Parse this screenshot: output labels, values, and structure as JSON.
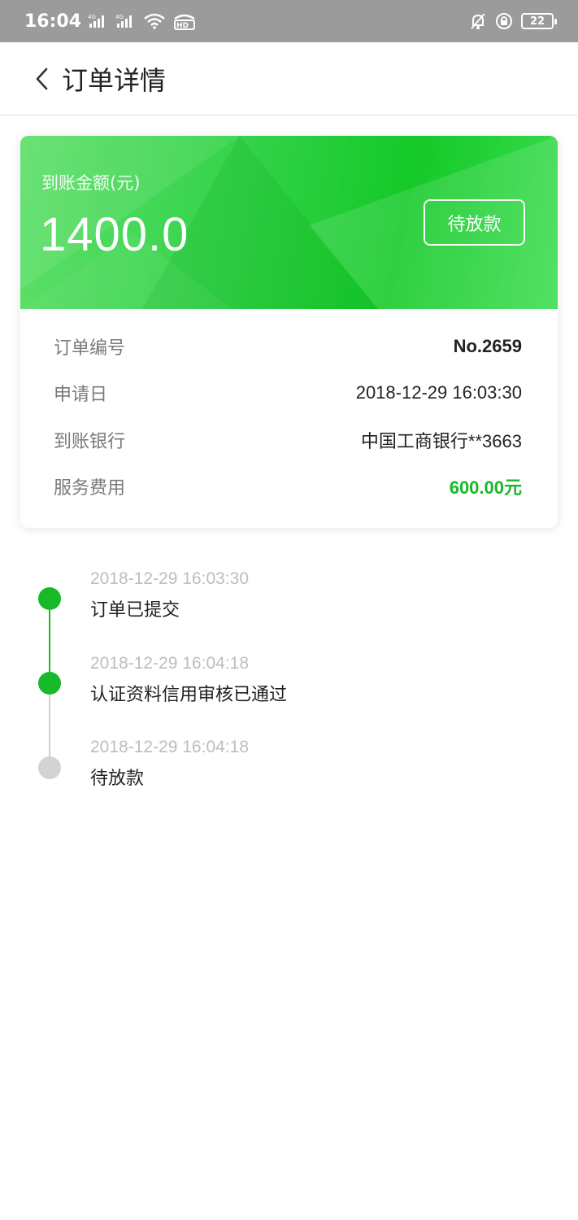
{
  "status_bar": {
    "time": "16:04",
    "battery": "22"
  },
  "nav": {
    "title": "订单详情"
  },
  "card": {
    "amount_label": "到账金额(元)",
    "amount_value": "1400.0",
    "status_badge": "待放款",
    "rows": [
      {
        "label": "订单编号",
        "value": "No.2659"
      },
      {
        "label": "申请日",
        "value": "2018-12-29 16:03:30"
      },
      {
        "label": "到账银行",
        "value": "中国工商银行**3663"
      },
      {
        "label": "服务费用",
        "value": "600.00元"
      }
    ]
  },
  "timeline": [
    {
      "time": "2018-12-29 16:03:30",
      "text": "订单已提交",
      "done": true
    },
    {
      "time": "2018-12-29 16:04:18",
      "text": "认证资料信用审核已通过",
      "done": true
    },
    {
      "time": "2018-12-29 16:04:18",
      "text": "待放款",
      "done": false
    }
  ],
  "colors": {
    "accent": "#17b928",
    "pending": "#d3d3d3",
    "line_done": "#17b928",
    "line_pending": "#d0d0d0"
  }
}
